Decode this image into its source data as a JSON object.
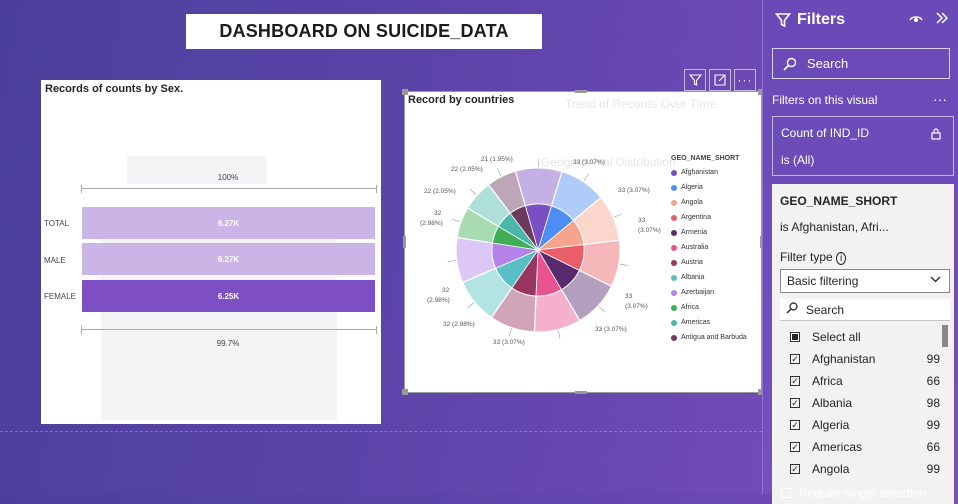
{
  "title": "DASHBOARD ON SUICIDE_DATA",
  "sex_chart": {
    "title": "Records of counts by Sex.",
    "top_pct": "100%",
    "bottom_pct": "99.7%",
    "rows": [
      {
        "label": "TOTAL",
        "value": "6.27K"
      },
      {
        "label": "MALE",
        "value": "6.27K"
      },
      {
        "label": "FEMALE",
        "value": "6.25K"
      }
    ]
  },
  "chart_data": {
    "type": "pie",
    "title": "Record by countries",
    "legend_title": "GEO_NAME_SHORT",
    "legend_placement": "right",
    "slices": [
      {
        "name": "Afghanistan",
        "label": "33 (3.07%)",
        "color": "#7b4fc4"
      },
      {
        "name": "Algeria",
        "label": "33 (3.07%)",
        "color": "#4e8ef2"
      },
      {
        "name": "Angola",
        "label": "33 (3.07%)",
        "color": "#f6a48d"
      },
      {
        "name": "Argentina",
        "label": "33 (3.07%)",
        "color": "#ea5e68"
      },
      {
        "name": "Armenia",
        "label": "33 (3.07%)",
        "color": "#5a2a6e"
      },
      {
        "name": "Australia",
        "label": "33 (3.07%)",
        "color": "#e8528d"
      },
      {
        "name": "Austria",
        "label": "32 (2.98%)",
        "color": "#9a3560"
      },
      {
        "name": "Albania",
        "label": "32 (2.98%)",
        "color": "#58c0c4"
      },
      {
        "name": "Azerbaijan",
        "label": "32 (2.98%)",
        "color": "#b483ea"
      },
      {
        "name": "Africa",
        "label": "22 (2.05%)",
        "color": "#3fae55"
      },
      {
        "name": "Americas",
        "label": "22 (2.05%)",
        "color": "#4ab8a8"
      },
      {
        "name": "Antigua and Barbuda",
        "label": "21 (1.95%)",
        "color": "#6d3a5e"
      }
    ]
  },
  "ghost_text": {
    "trend": "Trend of Records Over Time",
    "geo": "Geographical Distribution"
  },
  "filters": {
    "title": "Filters",
    "search_placeholder": "Search",
    "section": "Filters on this visual",
    "card1": {
      "field": "Count of IND_ID",
      "state": "is (All)"
    },
    "card2": {
      "field": "GEO_NAME_SHORT",
      "summary": "is Afghanistan, Afri...",
      "filter_type_label": "Filter type",
      "filter_type_value": "Basic filtering",
      "search_placeholder": "Search",
      "select_all": "Select all",
      "items": [
        {
          "name": "Afghanistan",
          "count": "99"
        },
        {
          "name": "Africa",
          "count": "66"
        },
        {
          "name": "Albania",
          "count": "98"
        },
        {
          "name": "Algeria",
          "count": "99"
        },
        {
          "name": "Americas",
          "count": "66"
        },
        {
          "name": "Angola",
          "count": "99"
        }
      ]
    },
    "require_single": "Require single selection"
  }
}
